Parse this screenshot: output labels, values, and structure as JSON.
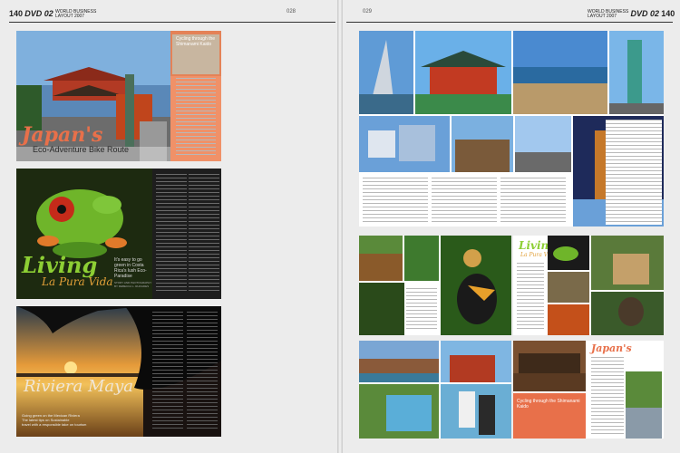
{
  "left_page": {
    "page_number": "140",
    "brand": "DVD 02",
    "sub_line1": "WORLD BUSINESS",
    "sub_line2": "LAYOUT 2007",
    "folio": "028",
    "spreads": [
      {
        "title": "Japan's",
        "subtitle": "Eco-Adventure Bike Route",
        "sidebar_title": "Cycling through the Shimanami Kaido",
        "accent_color": "#e8704a"
      },
      {
        "title": "Living",
        "subtitle": "La Pura Vida",
        "intro": "It's easy to go green in Costa Rica's lush Eco-Paradise",
        "credit": "STORY AND PHOTOGRAPHY BY REBECCA L. RHOADES"
      },
      {
        "title": "Riviera Maya",
        "intro": "Going green on the Mexican Riviera",
        "intro2": "The latest tips on Sustainable",
        "intro3": "travel with a responsible take on tourism"
      }
    ]
  },
  "right_page": {
    "page_number": "140",
    "brand": "DVD 02",
    "sub_line1": "WORLD BUSINESS",
    "sub_line2": "LAYOUT 2007",
    "folio": "029",
    "spreads": [
      {
        "label": "Japan collage spread"
      },
      {
        "title": "Living",
        "subtitle": "La Pura Vida"
      },
      {
        "title": "Japan's",
        "sidebar": "Cycling through the Shimanami Kaido"
      }
    ]
  }
}
